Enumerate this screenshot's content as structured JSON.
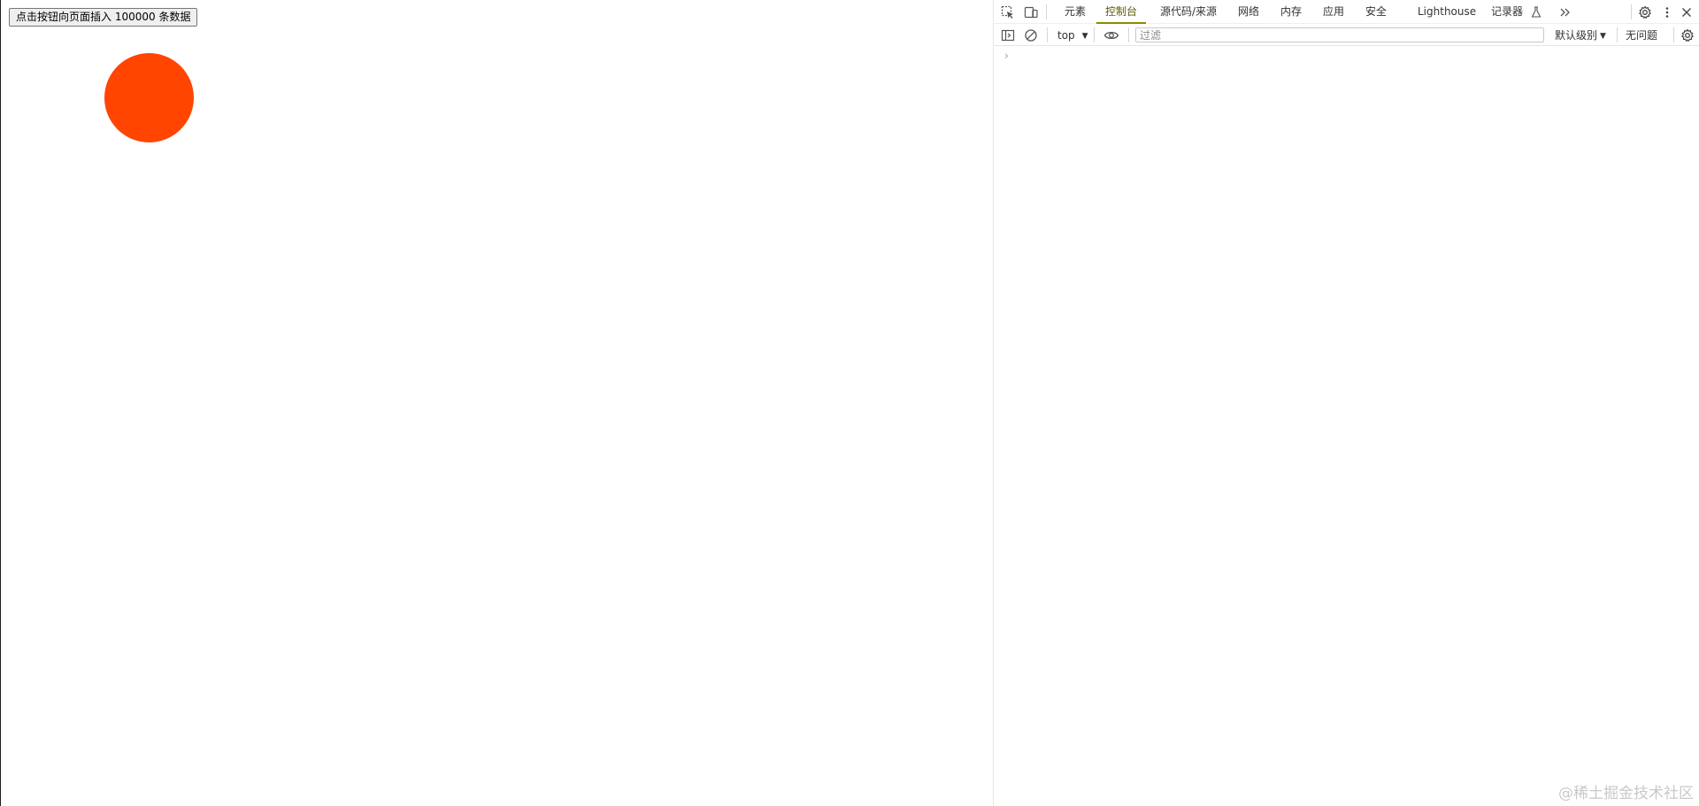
{
  "page": {
    "button_label": "点击按钮向页面插入 100000 条数据",
    "ball_color": "#ff4500"
  },
  "devtools": {
    "tabs": [
      {
        "label": "元素",
        "active": false
      },
      {
        "label": "控制台",
        "active": true
      },
      {
        "label": "源代码/来源",
        "active": false
      },
      {
        "label": "网络",
        "active": false
      },
      {
        "label": "内存",
        "active": false
      },
      {
        "label": "应用",
        "active": false
      },
      {
        "label": "安全",
        "active": false
      },
      {
        "label": "Lighthouse",
        "active": false
      },
      {
        "label": "记录器",
        "active": false
      }
    ],
    "toolbar": {
      "context": "top",
      "filter_placeholder": "过滤",
      "level": "默认级别",
      "issues": "无问题"
    },
    "console": {
      "prompt": "›"
    }
  },
  "watermark": "@稀土掘金技术社区"
}
